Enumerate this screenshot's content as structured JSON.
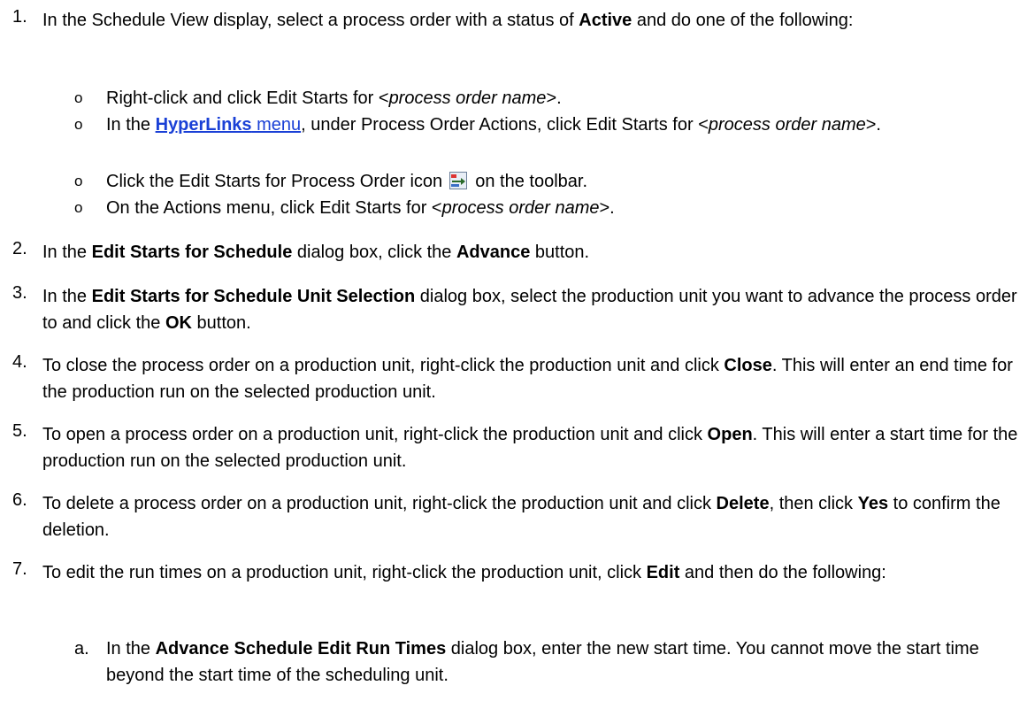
{
  "steps": [
    {
      "num": "1.",
      "p1": "In the Schedule View display, select a process order with a status of ",
      "b1": "Active",
      "p2": " and do one of the following:",
      "options": [
        {
          "bullet": "o",
          "a": "Right-click and click Edit Starts for <",
          "i": "process order name",
          "b": ">."
        },
        {
          "bullet": "o",
          "a": "In the ",
          "link_bold": "HyperLinks",
          "link_text": " menu",
          "c": ", under Process Order Actions, click Edit Starts for <",
          "i": "process order name",
          "d": ">."
        },
        {
          "bullet": "o",
          "a": "Click the Edit Starts for Process Order icon ",
          "icon": "edit-starts-icon",
          "b": " on the toolbar."
        },
        {
          "bullet": "o",
          "a": "On the Actions menu, click Edit Starts for <",
          "i": "process order name",
          "b": ">."
        }
      ]
    },
    {
      "num": "2.",
      "p1": "In the ",
      "b1": "Edit Starts for Schedule",
      "p2": " dialog box, click the ",
      "b2": "Advance",
      "p3": " button."
    },
    {
      "num": "3.",
      "p1": "In the ",
      "b1": "Edit Starts for Schedule Unit Selection",
      "p2": " dialog box, select the production unit you want to advance the process order to and click the ",
      "b2": "OK",
      "p3": " button."
    },
    {
      "num": "4.",
      "p1": "To close the process order on a production unit, right-click the production unit and click ",
      "b1": "Close",
      "p2": ". This will enter an end time for the production run on the selected production unit."
    },
    {
      "num": "5.",
      "p1": "To open a process order on a production unit, right-click the production unit and click ",
      "b1": "Open",
      "p2": ". This will enter a start time for the production run on the selected production unit."
    },
    {
      "num": "6.",
      "p1": "To delete a process order on a production unit, right-click the production unit and click ",
      "b1": "Delete",
      "p2": ", then click ",
      "b2": "Yes",
      "p3": " to confirm the deletion."
    },
    {
      "num": "7.",
      "p1": "To edit the run times on a production unit, right-click the production unit, click ",
      "b1": "Edit",
      "p2": " and then do the following:",
      "substeps": [
        {
          "label": "a.",
          "p1": "In the ",
          "b1": "Advance Schedule Edit Run Times",
          "p2": " dialog box, enter the new start time. You cannot move the start time beyond the start time of the scheduling unit."
        }
      ]
    }
  ],
  "colors": {
    "link": "#1a40d6",
    "text": "#000000"
  }
}
